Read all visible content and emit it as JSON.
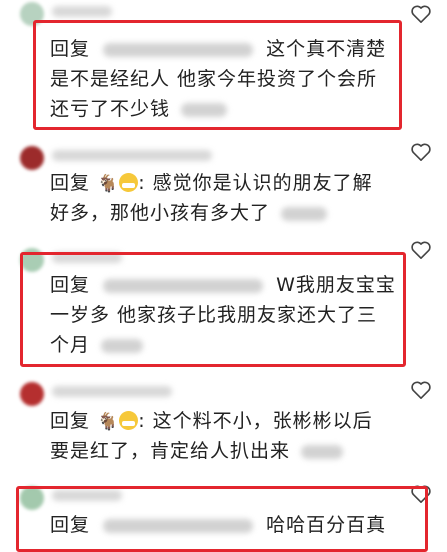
{
  "icons": {
    "heart": "heart-outline-icon",
    "goat": "goat-emoji",
    "mask": "mask-face-emoji"
  },
  "colors": {
    "highlight": "#e3262e",
    "text": "#222222",
    "blur": "#d2d2d2"
  },
  "comments": [
    {
      "avatar_color": "#b7d2c0",
      "lines": [
        "回复",
        "这个真不清楚",
        "是不是经纪人  他家今年投资了个会所",
        "还亏了不少钱"
      ]
    },
    {
      "avatar_color": "#9c2b2b",
      "prefix": "回复",
      "emoji_goat": "🐐",
      "emoji_face": "",
      "lines": [
        ": 感觉你是认识的朋友了解",
        "好多，那他小孩有多大了"
      ]
    },
    {
      "avatar_color": "#a9cdb4",
      "lines": [
        "回复",
        "W我朋友宝宝",
        "一岁多 他家孩子比我朋友家还大了三",
        "个月"
      ]
    },
    {
      "avatar_color": "#b52f2f",
      "prefix": "回复",
      "emoji_goat": "🐐",
      "lines": [
        ": 这个料不小，张彬彬以后",
        "要是红了，肯定给人扒出来"
      ]
    },
    {
      "avatar_color": "#a3c9ad",
      "lines": [
        "回复",
        "哈哈百分百真"
      ]
    }
  ]
}
